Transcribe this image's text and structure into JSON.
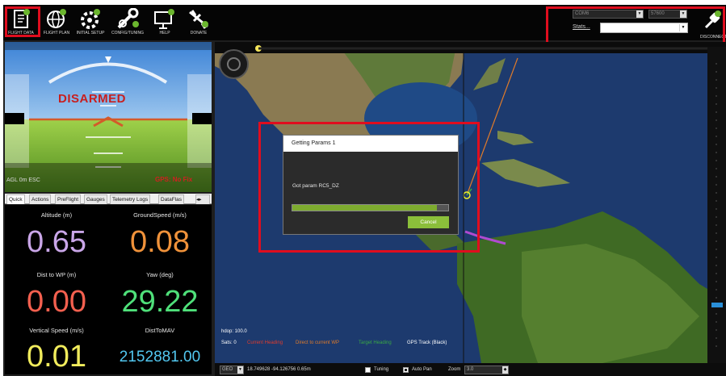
{
  "toolbar": {
    "items": [
      {
        "label": "FLIGHT DATA",
        "icon": "flight-data-icon"
      },
      {
        "label": "FLIGHT PLAN",
        "icon": "globe-icon"
      },
      {
        "label": "INITIAL SETUP",
        "icon": "gear-icon"
      },
      {
        "label": "CONFIG/TUNING",
        "icon": "wrench-icon"
      },
      {
        "label": "HELP",
        "icon": "monitor-icon"
      },
      {
        "label": "DONATE",
        "icon": "airplane-icon"
      }
    ]
  },
  "connection": {
    "port": "COM6",
    "baud": "57600",
    "stats_label": "Stats...",
    "connect_label": "DISCONNECT"
  },
  "hud": {
    "armed_text": "DISARMED",
    "status_line": "AGL 0m  ESC",
    "gps_text": "GPS: No Fix"
  },
  "tabs": [
    "Quick",
    "Actions",
    "PreFlight",
    "Gauges",
    "Telemetry Logs",
    "DataFlas"
  ],
  "quick": [
    {
      "label": "Altitude (m)",
      "value": "0.65",
      "color": "#c9a6e8"
    },
    {
      "label": "GroundSpeed (m/s)",
      "value": "0.08",
      "color": "#f0923a"
    },
    {
      "label": "Dist to WP (m)",
      "value": "0.00",
      "color": "#f4604f"
    },
    {
      "label": "Yaw (deg)",
      "value": "29.22",
      "color": "#4fe07a"
    },
    {
      "label": "Vertical Speed (m/s)",
      "value": "0.01",
      "color": "#f1ec5c"
    },
    {
      "label": "DistToMAV",
      "value": "2152881.00",
      "color": "#52c7f0"
    }
  ],
  "map": {
    "hdop": "hdop: 100.0",
    "sats": "Sats: 0",
    "legend": [
      {
        "label": "Current Heading",
        "color": "#e23c2c"
      },
      {
        "label": "Direct to current WP",
        "color": "#e07b2a"
      },
      {
        "label": "Target Heading",
        "color": "#39a845"
      },
      {
        "label": "GPS Track (Black)",
        "color": "#ffffff"
      }
    ]
  },
  "dialog": {
    "title": "Getting Params 1",
    "message": "Got param RC5_DZ",
    "progress": 0.93,
    "cancel_label": "Cancel"
  },
  "bottom": {
    "zoom_combo": "GEO",
    "coords": "18.749628 -94.126756  0.65m",
    "tuning_label": "Tuning",
    "autopan_label": "Auto Pan",
    "zoom_label": "Zoom",
    "zoom_value": "3.0"
  }
}
